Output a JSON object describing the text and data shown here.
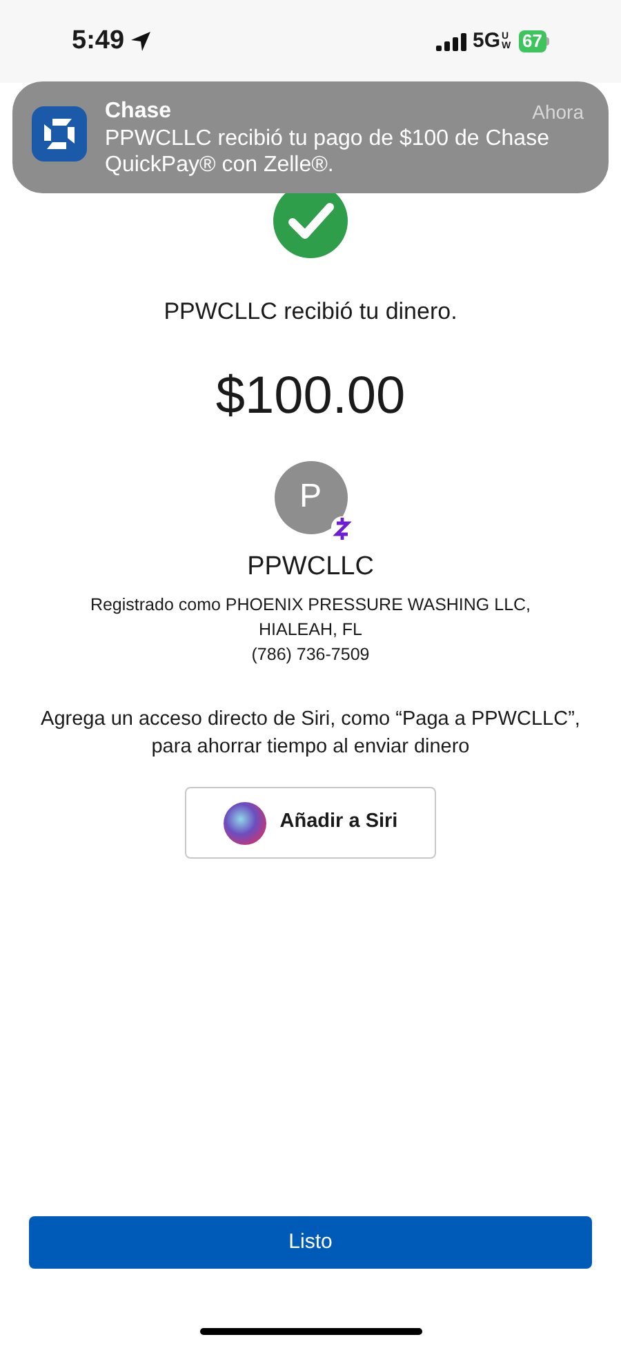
{
  "status_bar": {
    "time": "5:49",
    "network": "5G",
    "network_badge": "UW",
    "battery": "67"
  },
  "notification": {
    "app": "Chase",
    "time": "Ahora",
    "message": "PPWCLLC recibió tu pago de $100 de Chase QuickPay® con Zelle®."
  },
  "confirmation": {
    "message": "PPWCLLC recibió tu dinero.",
    "amount": "$100.00"
  },
  "recipient": {
    "initial": "P",
    "name": "PPWCLLC",
    "registered": "Registrado como PHOENIX PRESSURE WASHING LLC, HIALEAH, FL",
    "phone": "(786) 736-7509"
  },
  "siri": {
    "prompt": "Agrega un acceso directo de Siri, como “Paga a PPWCLLC”, para ahorrar tiempo al enviar dinero",
    "button": "Añadir a Siri"
  },
  "done_button": "Listo"
}
